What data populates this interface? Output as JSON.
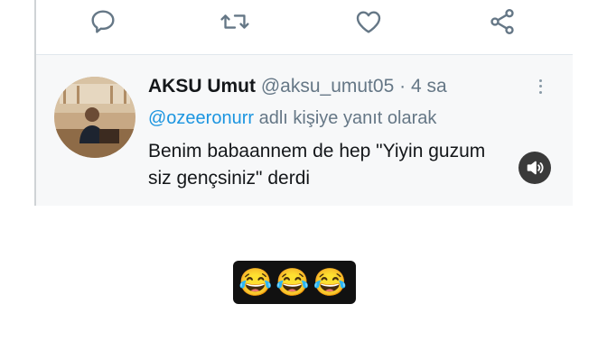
{
  "actions": [
    {
      "icon": "reply-icon"
    },
    {
      "icon": "retweet-icon"
    },
    {
      "icon": "like-icon"
    },
    {
      "icon": "share-icon"
    }
  ],
  "reply_tweet": {
    "author_name": "AKSU Umut",
    "handle": "@aksu_umut05",
    "separator": "·",
    "time": "4 sa",
    "mention": "@ozeeronurr",
    "replying_suffix": "adlı kişiye yanıt olarak",
    "text_line1": "Benim babaannem de hep \"Yiyin guzum",
    "text_line2": "siz gençsiniz\" derdi",
    "more_icon": "more-vertical-icon",
    "sound_icon": "speaker-icon"
  },
  "caption": {
    "emojis": "😂😂😂"
  },
  "colors": {
    "link": "#1b95e0",
    "muted": "#657786",
    "text": "#14171a",
    "icon": "#657786"
  }
}
